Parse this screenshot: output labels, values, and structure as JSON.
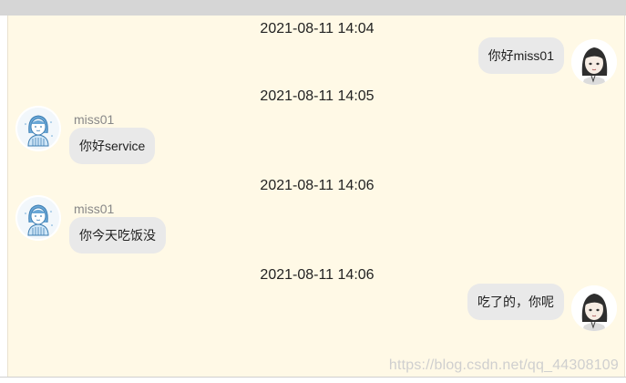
{
  "messages": [
    {
      "time": "2021-08-11 14:04",
      "sender": "",
      "text": "你好miss01",
      "side": "right",
      "avatar": "girl-avatar-icon"
    },
    {
      "time": "2021-08-11 14:05",
      "sender": "miss01",
      "text": "你好service",
      "side": "left",
      "avatar": "user-avatar-icon"
    },
    {
      "time": "2021-08-11 14:06",
      "sender": "miss01",
      "text": "你今天吃饭没",
      "side": "left",
      "avatar": "user-avatar-icon"
    },
    {
      "time": "2021-08-11 14:06",
      "sender": "",
      "text": "吃了的，你呢",
      "side": "right",
      "avatar": "girl-avatar-icon"
    }
  ],
  "watermark": "https://blog.csdn.net/qq_44308109",
  "colors": {
    "chat_background": "#fff9e6",
    "bubble": "#e9e9e9",
    "top_bar": "#d6d6d6"
  }
}
